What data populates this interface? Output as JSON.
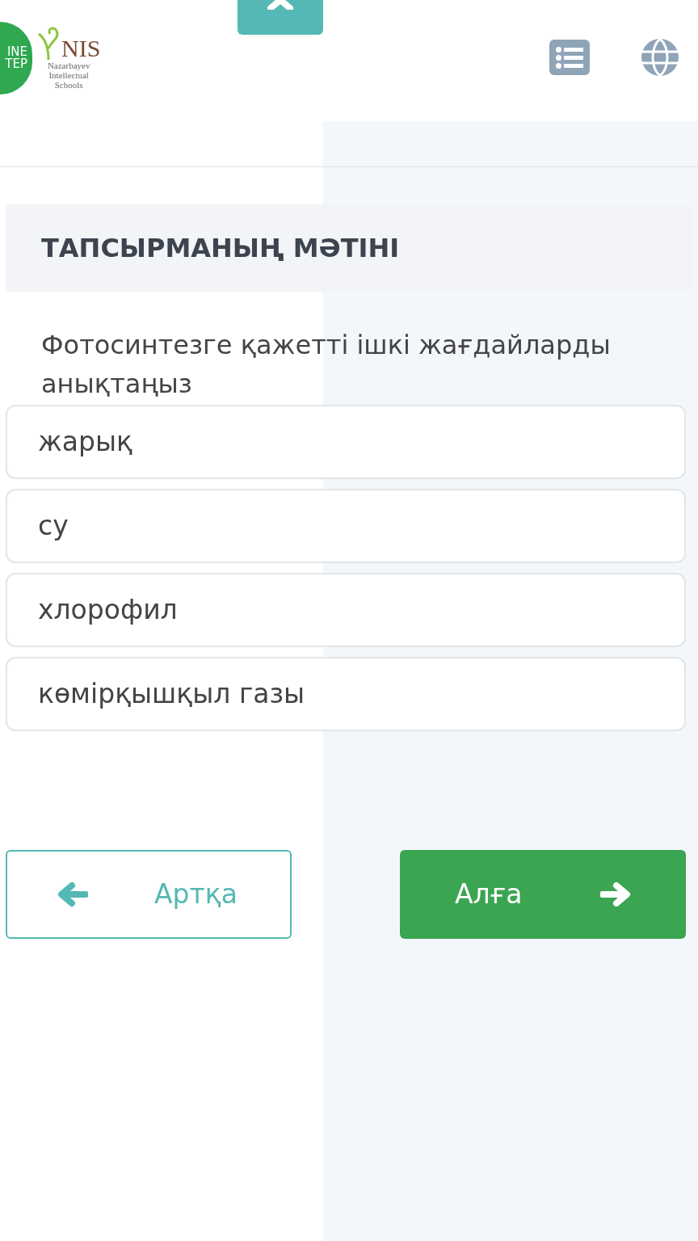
{
  "header": {
    "logo_text": [
      "INE",
      "TEP"
    ],
    "nis_logo": {
      "title": "NIS",
      "lines": [
        "Nazarbayev",
        "Intellectual",
        "Schools"
      ]
    }
  },
  "task": {
    "heading": "ТАПСЫРМАНЫҢ МӘТІНІ",
    "question": "Фотосинтезге қажетті ішкі жағдайларды анықтаңыз",
    "options": [
      {
        "label": "жарық"
      },
      {
        "label": "су"
      },
      {
        "label": "хлорофил"
      },
      {
        "label": "көмірқышқыл газы"
      }
    ]
  },
  "navigation": {
    "back": "Артқа",
    "next": "Алға"
  }
}
